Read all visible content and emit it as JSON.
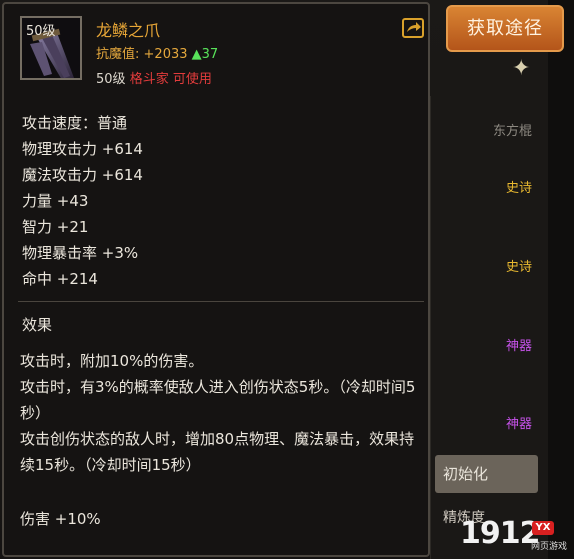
{
  "get_button": "获取途径",
  "item": {
    "level_badge": "50级",
    "name": "龙鳞之爪",
    "demon_label": "抗魔值:",
    "demon_value": "+2033",
    "demon_up": "▲37",
    "req_level": "50级",
    "req_class": "格斗家 可使用"
  },
  "stats": [
    "攻击速度：普通",
    "物理攻击力 +614",
    "魔法攻击力 +614",
    "力量 +43",
    "智力 +21",
    "物理暴击率 +3%",
    "命中 +214"
  ],
  "effects_title": "效果",
  "effects": [
    "攻击时，附加10%的伤害。",
    "攻击时，有3%的概率使敌人进入创伤状态5秒。（冷却时间5秒）",
    "攻击创伤状态的敌人时，增加80点物理、魔法暴击，效果持续15秒。（冷却时间15秒）"
  ],
  "damage_line": "伤害 +10%",
  "background": {
    "rows": [
      {
        "text": "东方棍",
        "style": "dim"
      },
      {
        "text": "史诗",
        "style": "gold"
      },
      {
        "text": "史诗",
        "style": "gold"
      },
      {
        "text": "神器",
        "style": "purple"
      },
      {
        "text": "神器",
        "style": "purple"
      }
    ],
    "init_button": "初始化",
    "bottom_label": "精炼度"
  },
  "watermark": {
    "main": "1912",
    "badge": "YX",
    "sub": "网页游戏"
  }
}
